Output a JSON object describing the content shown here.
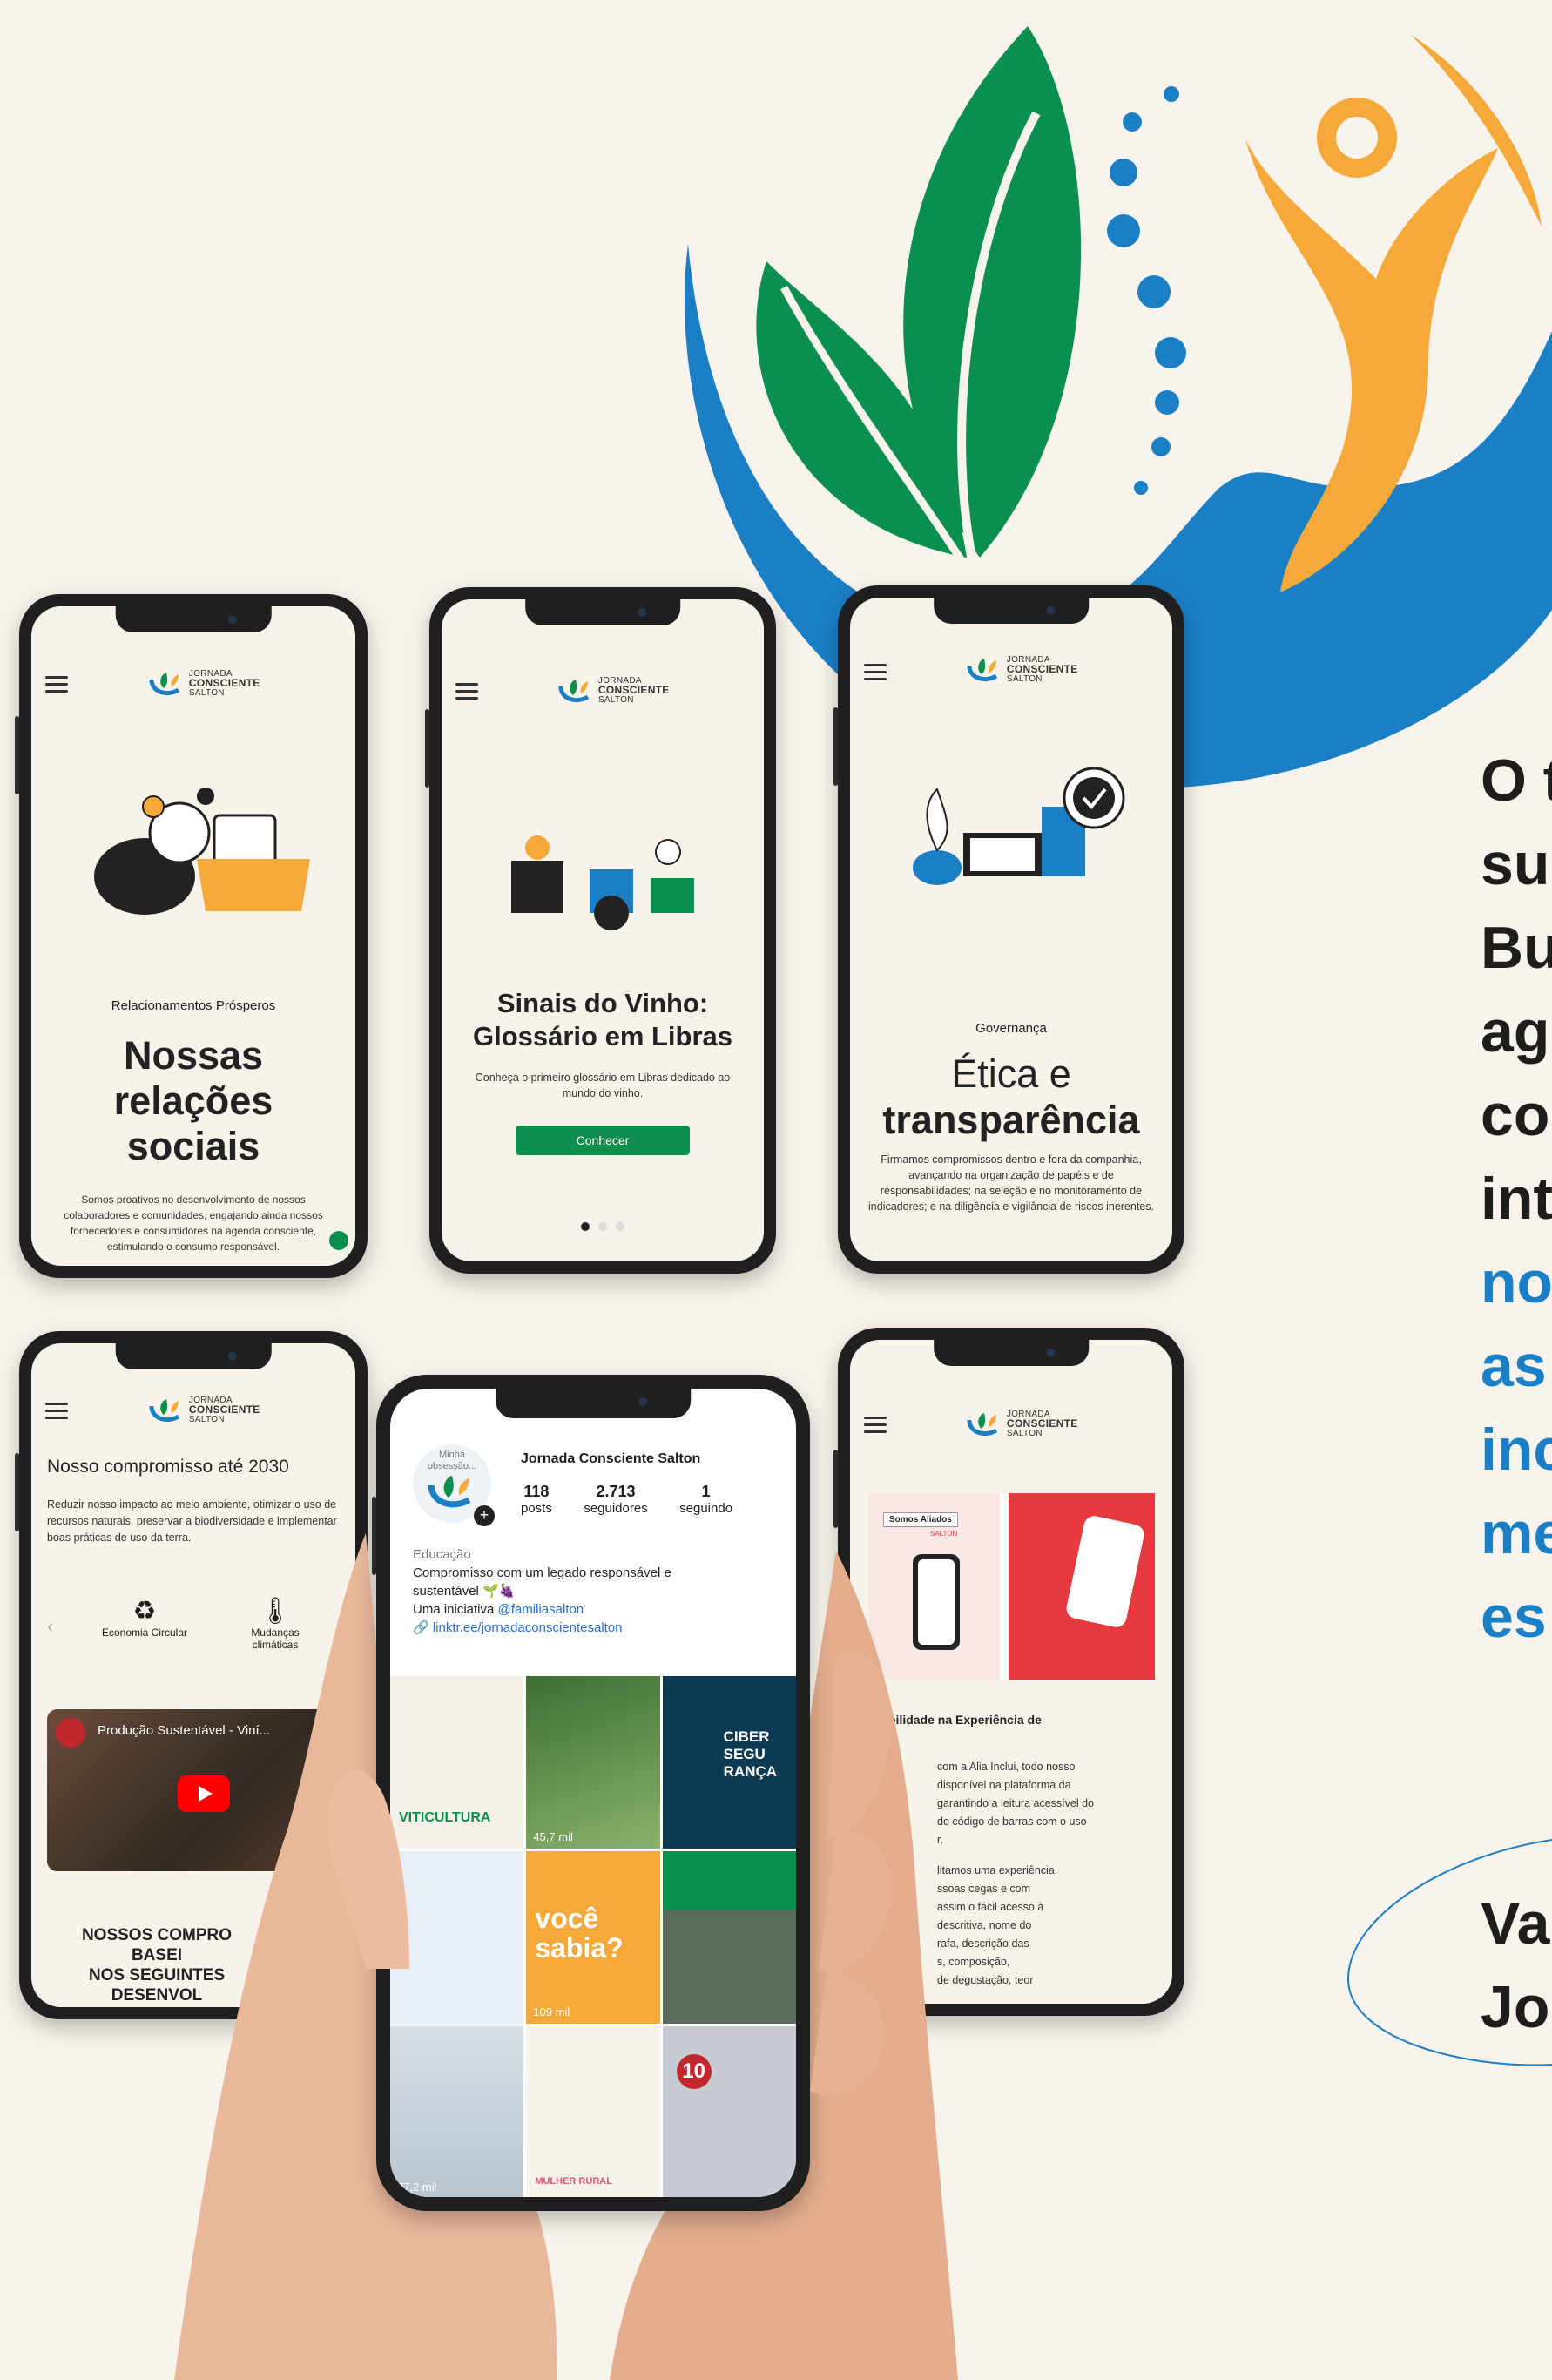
{
  "brand": {
    "name": "JORNADA",
    "name2": "CONSCIENTE",
    "sub": "SALTON",
    "colors": {
      "green": "#0b8f4e",
      "blue": "#1b7fc6",
      "orange": "#f6a93b",
      "bg": "#f8f3ec",
      "red": "#e63a3f"
    }
  },
  "phone1": {
    "kicker": "Relacionamentos Prósperos",
    "title_lines": [
      "Nossas",
      "relações",
      "sociais"
    ],
    "body": "Somos proativos no desenvolvimento de nossos colaboradores e comunidades, engajando ainda nossos fornecedores e consumidores na agenda consciente, estimulando o consumo responsável."
  },
  "phone2": {
    "title_lines": [
      "Sinais do Vinho:",
      "Glossário em Libras"
    ],
    "body": "Conheça o primeiro glossário em Libras dedicado ao mundo do vinho.",
    "button": "Conhecer"
  },
  "phone3": {
    "kicker": "Governança",
    "title_lines": [
      "Ética e",
      "transparência"
    ],
    "body": "Firmamos compromissos dentro e fora da companhia, avançando na organização de papéis e de responsabilidades; na seleção e no monitoramento de indicadores; e na diligência e vigilância de riscos inerentes."
  },
  "phone4": {
    "title": "Nosso compromisso até 2030",
    "body": "Reduzir nosso impacto ao meio ambiente, otimizar o uso de recursos naturais, preservar a biodiversidade e implementar boas práticas de uso da terra.",
    "items": [
      "Economia Circular",
      "Mudanças climáticas"
    ],
    "video_title": "Produção Sustentável - Viní...",
    "footer_lines": [
      "NOSSOS COMPRO",
      "BASEI",
      "NOS SEGUINTES",
      "DESENVOL"
    ]
  },
  "phone5": {
    "card_label": "Somos Aliados",
    "card_brand": "SALTON",
    "section_title": "bilidade na Experiência de",
    "section_title2": "o",
    "body_lines": [
      "com a Alia Inclui, todo nosso",
      "disponível na plataforma da",
      "garantindo a leitura acessível do",
      "do código de barras com o uso",
      "r.",
      "",
      "litamos uma experiência",
      "ssoas cegas e com",
      "assim o fácil acesso à",
      "descritiva, nome do",
      "rafa, descrição das",
      "s, composição,",
      "de degustação, teor"
    ]
  },
  "instagram": {
    "story_label": "Minha obsessão...",
    "username": "Jornada Consciente Salton",
    "stats": [
      {
        "value": "118",
        "label": "posts"
      },
      {
        "value": "2.713",
        "label": "seguidores"
      },
      {
        "value": "1",
        "label": "seguindo"
      }
    ],
    "category": "Educação",
    "bio_line1": "Compromisso com um legado responsável e",
    "bio_line2": "sustentável 🌱🍇",
    "bio_line3_prefix": "Uma iniciativa",
    "bio_mention": "@familiasalton",
    "link": "linktr.ee/jornadaconscientesalton",
    "posts": [
      {
        "text": "VITICULTURA",
        "views": ""
      },
      {
        "text": "",
        "views": "45,7 mil"
      },
      {
        "text": "CIBER SEGU RANÇA",
        "views": ""
      },
      {
        "text": "",
        "views": ""
      },
      {
        "text": "você sabia?",
        "views": "109 mil"
      },
      {
        "text": "",
        "views": ""
      },
      {
        "text": "",
        "views": "77,2 mil"
      },
      {
        "text": "MULHER RURAL",
        "views": ""
      },
      {
        "text": "10",
        "views": ""
      }
    ]
  },
  "right_text": {
    "lines": [
      "O t",
      "su",
      "Bu",
      "ag",
      "co",
      "int"
    ],
    "blue_lines": [
      "no",
      "as",
      "inc",
      "me",
      "es"
    ],
    "cta_lines": [
      "Va",
      "Jo"
    ]
  }
}
